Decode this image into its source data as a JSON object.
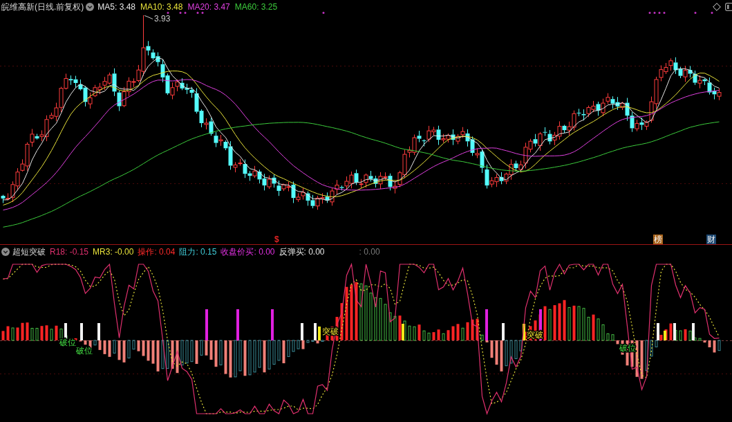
{
  "main_panel": {
    "title": "皖维高新(日线.前复权)",
    "legend": [
      {
        "label": "MA5: 3.48",
        "color": "#e6e6e6"
      },
      {
        "label": "MA10: 3.48",
        "color": "#e8e23a"
      },
      {
        "label": "MA20: 3.47",
        "color": "#e040e0"
      },
      {
        "label": "MA60: 3.25",
        "color": "#3ccc3c"
      }
    ],
    "high_label": "3.93",
    "markers": [
      {
        "kind": "glyph",
        "text": "$",
        "color": "#e02424"
      },
      {
        "kind": "badge",
        "text": "榜",
        "color": "#a8641c"
      },
      {
        "kind": "badge",
        "text": "财",
        "color": "#1c4872"
      }
    ]
  },
  "indicator_panel": {
    "title": "超短突破",
    "legend": [
      {
        "label": "R18: -0.15",
        "color": "#e0306e"
      },
      {
        "label": "MR3: -0.00",
        "color": "#e8e23a"
      },
      {
        "label": "操作: 0.04",
        "color": "#ff2a2a"
      },
      {
        "label": "阻力: 0.15",
        "color": "#40ccd8"
      },
      {
        "label": "收盘价买: 0.00",
        "color": "#e030e0"
      },
      {
        "label": "反弹买: 0.00",
        "color": "#e6e6e6"
      },
      {
        "label": ": 0.00",
        "color": "#7a7a7a"
      }
    ],
    "signals": [
      {
        "kind": "down",
        "text": "破位"
      },
      {
        "kind": "down",
        "text": "破位"
      },
      {
        "kind": "up",
        "text": "突破"
      },
      {
        "kind": "up",
        "text": "突破"
      },
      {
        "kind": "down",
        "text": "破位"
      }
    ]
  }
}
